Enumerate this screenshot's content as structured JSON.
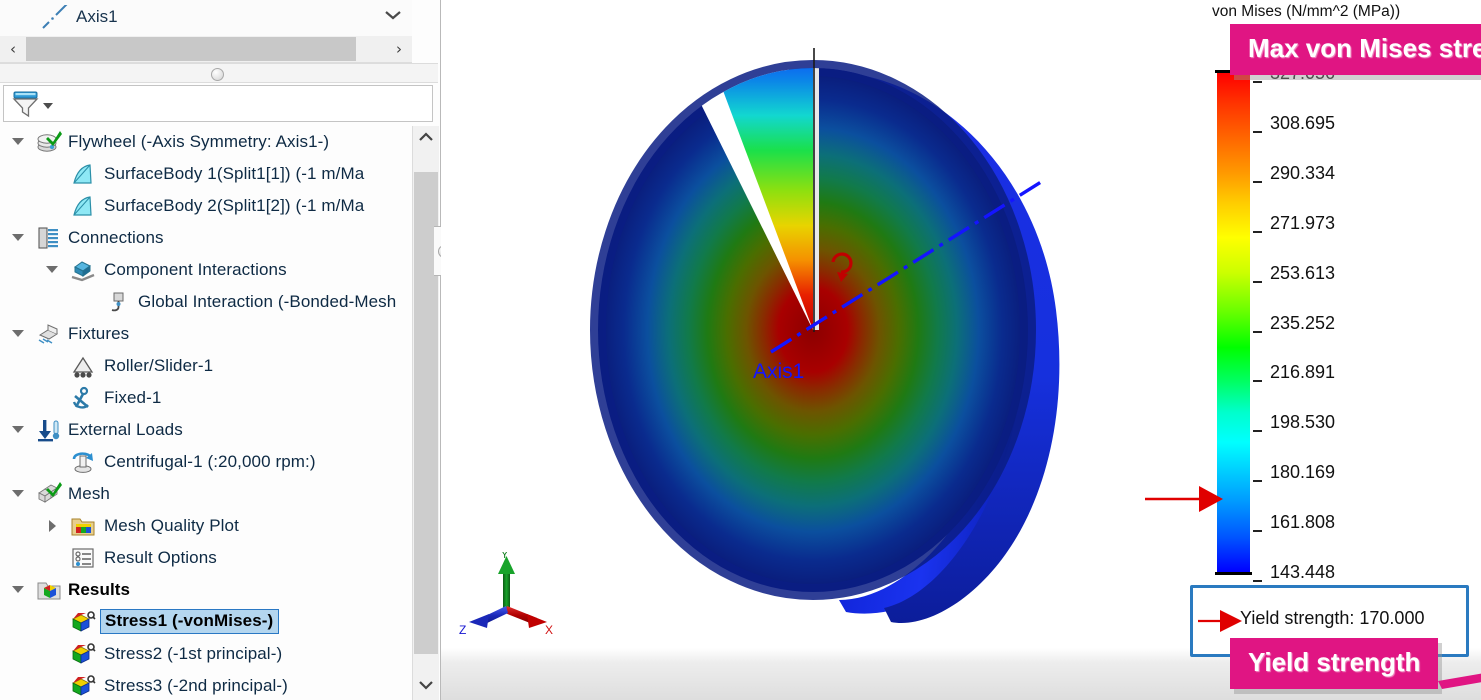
{
  "panel": {
    "stub": {
      "label": "Axis1",
      "icon": "axis-icon",
      "chevron": "⌄"
    },
    "hscroll": {
      "left_arrow": "‹",
      "right_arrow": "›"
    },
    "filter": {
      "icon": "filter-funnel-icon",
      "placeholder": ""
    },
    "scrollbar": {
      "up": "⌃",
      "down": "⌄"
    },
    "tree": [
      {
        "label": "Flywheel (-Axis Symmetry: Axis1-)",
        "indent": 0,
        "twisty": "down",
        "icon": "study-check-icon",
        "state": "normal"
      },
      {
        "label": "SurfaceBody 1(Split1[1]) (-1 m/Ma",
        "indent": 1,
        "twisty": "none",
        "icon": "surface-body-icon",
        "state": "normal"
      },
      {
        "label": "SurfaceBody 2(Split1[2]) (-1 m/Ma",
        "indent": 1,
        "twisty": "none",
        "icon": "surface-body-icon",
        "state": "normal"
      },
      {
        "label": "Connections",
        "indent": 0,
        "twisty": "down",
        "icon": "connections-bolt-icon",
        "state": "normal"
      },
      {
        "label": "Component Interactions",
        "indent": 1,
        "twisty": "down",
        "icon": "component-interactions-icon",
        "state": "normal"
      },
      {
        "label": "Global Interaction (-Bonded-Mesh",
        "indent": 2,
        "twisty": "none",
        "icon": "global-interaction-icon",
        "state": "normal"
      },
      {
        "label": "Fixtures",
        "indent": 0,
        "twisty": "down",
        "icon": "fixtures-icon",
        "state": "normal"
      },
      {
        "label": "Roller/Slider-1",
        "indent": 1,
        "twisty": "none",
        "icon": "roller-slider-icon",
        "state": "normal"
      },
      {
        "label": "Fixed-1",
        "indent": 1,
        "twisty": "none",
        "icon": "fixed-anchor-icon",
        "state": "normal"
      },
      {
        "label": "External Loads",
        "indent": 0,
        "twisty": "down",
        "icon": "external-loads-icon",
        "state": "normal"
      },
      {
        "label": "Centrifugal-1 (:20,000 rpm:)",
        "indent": 1,
        "twisty": "none",
        "icon": "centrifugal-icon",
        "state": "normal"
      },
      {
        "label": "Mesh",
        "indent": 0,
        "twisty": "down",
        "icon": "mesh-check-icon",
        "state": "normal"
      },
      {
        "label": "Mesh Quality Plot",
        "indent": 1,
        "twisty": "right",
        "icon": "mesh-quality-folder-icon",
        "state": "normal"
      },
      {
        "label": "Result Options",
        "indent": 1,
        "twisty": "none",
        "icon": "result-options-icon",
        "state": "normal"
      },
      {
        "label": "Results",
        "indent": 0,
        "twisty": "down",
        "icon": "results-folder-icon",
        "state": "bold"
      },
      {
        "label": "Stress1 (-vonMises-)",
        "indent": 1,
        "twisty": "none",
        "icon": "stress-plot-icon",
        "state": "selected"
      },
      {
        "label": "Stress2 (-1st principal-)",
        "indent": 1,
        "twisty": "none",
        "icon": "stress-plot-icon",
        "state": "normal"
      },
      {
        "label": "Stress3 (-2nd principal-)",
        "indent": 1,
        "twisty": "none",
        "icon": "stress-plot-icon",
        "state": "normal"
      }
    ]
  },
  "graphics": {
    "axis_label": "Axis1",
    "triad": {
      "x": "X",
      "y": "Y",
      "z": "Z"
    }
  },
  "legend": {
    "title": "von Mises (N/mm^2 (MPa))",
    "pointer_value": "170.000",
    "yield": {
      "label": "Yield strength: 170.000"
    }
  },
  "callouts": {
    "max_stress": "Max von Mises stress",
    "yield_strength": "Yield strength"
  },
  "colors": {
    "callout_pink": "#e01583",
    "yield_box_border": "#2a7ac0",
    "pointer_red": "#e00000",
    "selection_fill": "#b4d6ef",
    "selection_border": "#2a78c4",
    "tree_text": "#0e2a44"
  },
  "chart_data": {
    "type": "heatmap",
    "title": "von Mises (N/mm^2 (MPa))",
    "units": "N/mm^2 (MPa)",
    "tick_labels": [
      "327.056",
      "308.695",
      "290.334",
      "271.973",
      "253.613",
      "235.252",
      "216.891",
      "198.530",
      "180.169",
      "161.808",
      "143.448"
    ],
    "values": [
      327.056,
      308.695,
      290.334,
      271.973,
      253.613,
      235.252,
      216.891,
      198.53,
      180.169,
      161.808,
      143.448
    ],
    "vmin": 143.448,
    "vmax": 327.056,
    "colormap": [
      "#0000ff",
      "#00ffff",
      "#00ff00",
      "#ffff00",
      "#ff0000"
    ],
    "annotations": [
      {
        "name": "yield-strength-marker",
        "value": 170.0,
        "label": "Yield strength: 170.000",
        "color": "#e00000"
      },
      {
        "name": "max-stress-callout",
        "value": 327.056,
        "label": "Max von Mises stress",
        "color": "#e01583"
      }
    ],
    "legend_position": "right"
  }
}
